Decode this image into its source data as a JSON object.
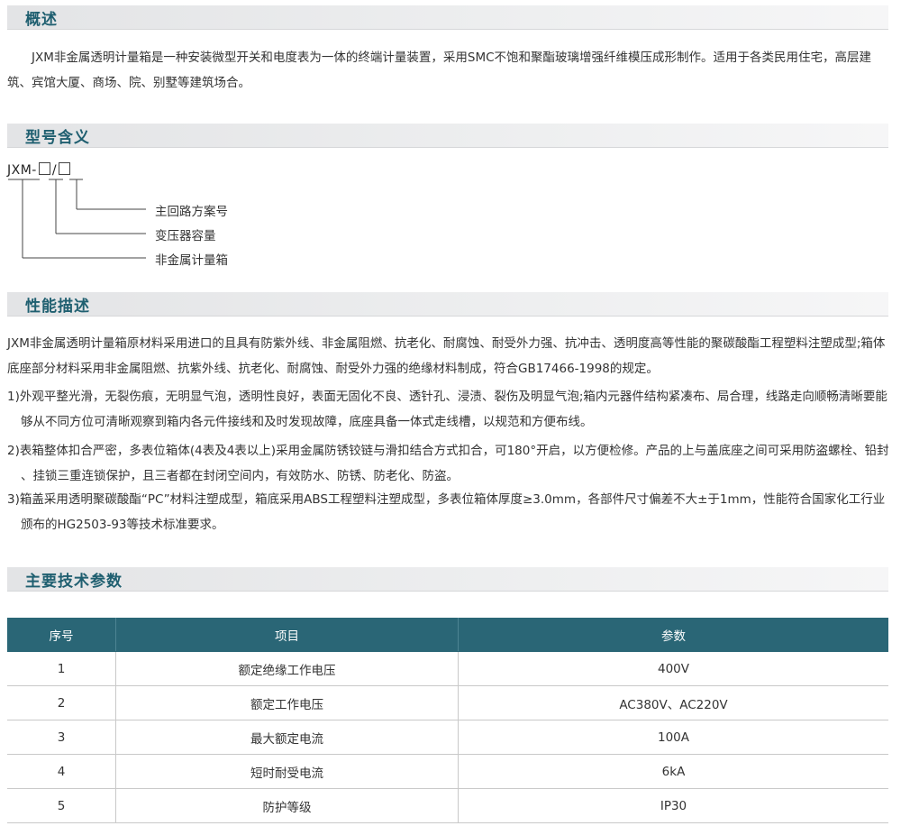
{
  "overview": {
    "heading": "概述",
    "text": "JXM非金属透明计量箱是一种安装微型开关和电度表为一体的终端计量装置，采用SMC不饱和聚酯玻璃增强纤维模压成形制作。适用于各类民用住宅，高层建筑、宾馆大厦、商场、院、别墅等建筑场合。"
  },
  "model": {
    "heading": "型号含义",
    "prefix": "JXM-",
    "separator": "/",
    "labels": [
      "主回路方案号",
      "变压器容量",
      "非金属计量箱"
    ]
  },
  "performance": {
    "heading": "性能描述",
    "intro": "JXM非金属透明计量箱原材料采用进口的且具有防紫外线、非金属阻燃、抗老化、耐腐蚀、耐受外力强、抗冲击、透明度高等性能的聚碳酸酯工程塑料注塑成型;箱体底座部分材料采用非金属阻燃、抗紫外线、抗老化、耐腐蚀、耐受外力强的绝缘材料制成，符合GB17466-1998的规定。",
    "items": [
      "1)外观平整光滑，无裂伤痕，无明显气泡，透明性良好，表面无固化不良、透针孔、浸渍、裂伤及明显气泡;箱内元器件结构紧凑布、局合理，线路走向顺畅清晰要能够从不同方位可清晰观察到箱内各元件接线和及时发现故障，底座具备一体式走线槽，以规范和方便布线。",
      "2)表箱整体扣合严密，多表位箱体(4表及4表以上)采用金属防锈铰链与滑扣结合方式扣合，可180°开启，以方便检修。产品的上与盖底座之间可采用防盗螺栓、铅封 、挂锁三重连锁保护，且三者都在封闭空间内，有效防水、防锈、防老化、防盗。",
      "3)箱盖采用透明聚碳酸酯“PC”材料注塑成型，箱底采用ABS工程塑料注塑成型，多表位箱体厚度≥3.0mm，各部件尺寸偏差不大±于1mm，性能符合国家化工行业颁布的HG2503-93等技术标准要求。"
    ]
  },
  "specs": {
    "heading": "主要技术参数",
    "columns": [
      "序号",
      "项目",
      "参数"
    ],
    "rows": [
      [
        "1",
        "额定绝缘工作电压",
        "400V"
      ],
      [
        "2",
        "额定工作电压",
        "AC380V、AC220V"
      ],
      [
        "3",
        "最大额定电流",
        "100A"
      ],
      [
        "4",
        "短时耐受电流",
        "6kA"
      ],
      [
        "5",
        "防护等级",
        "IP30"
      ]
    ]
  }
}
